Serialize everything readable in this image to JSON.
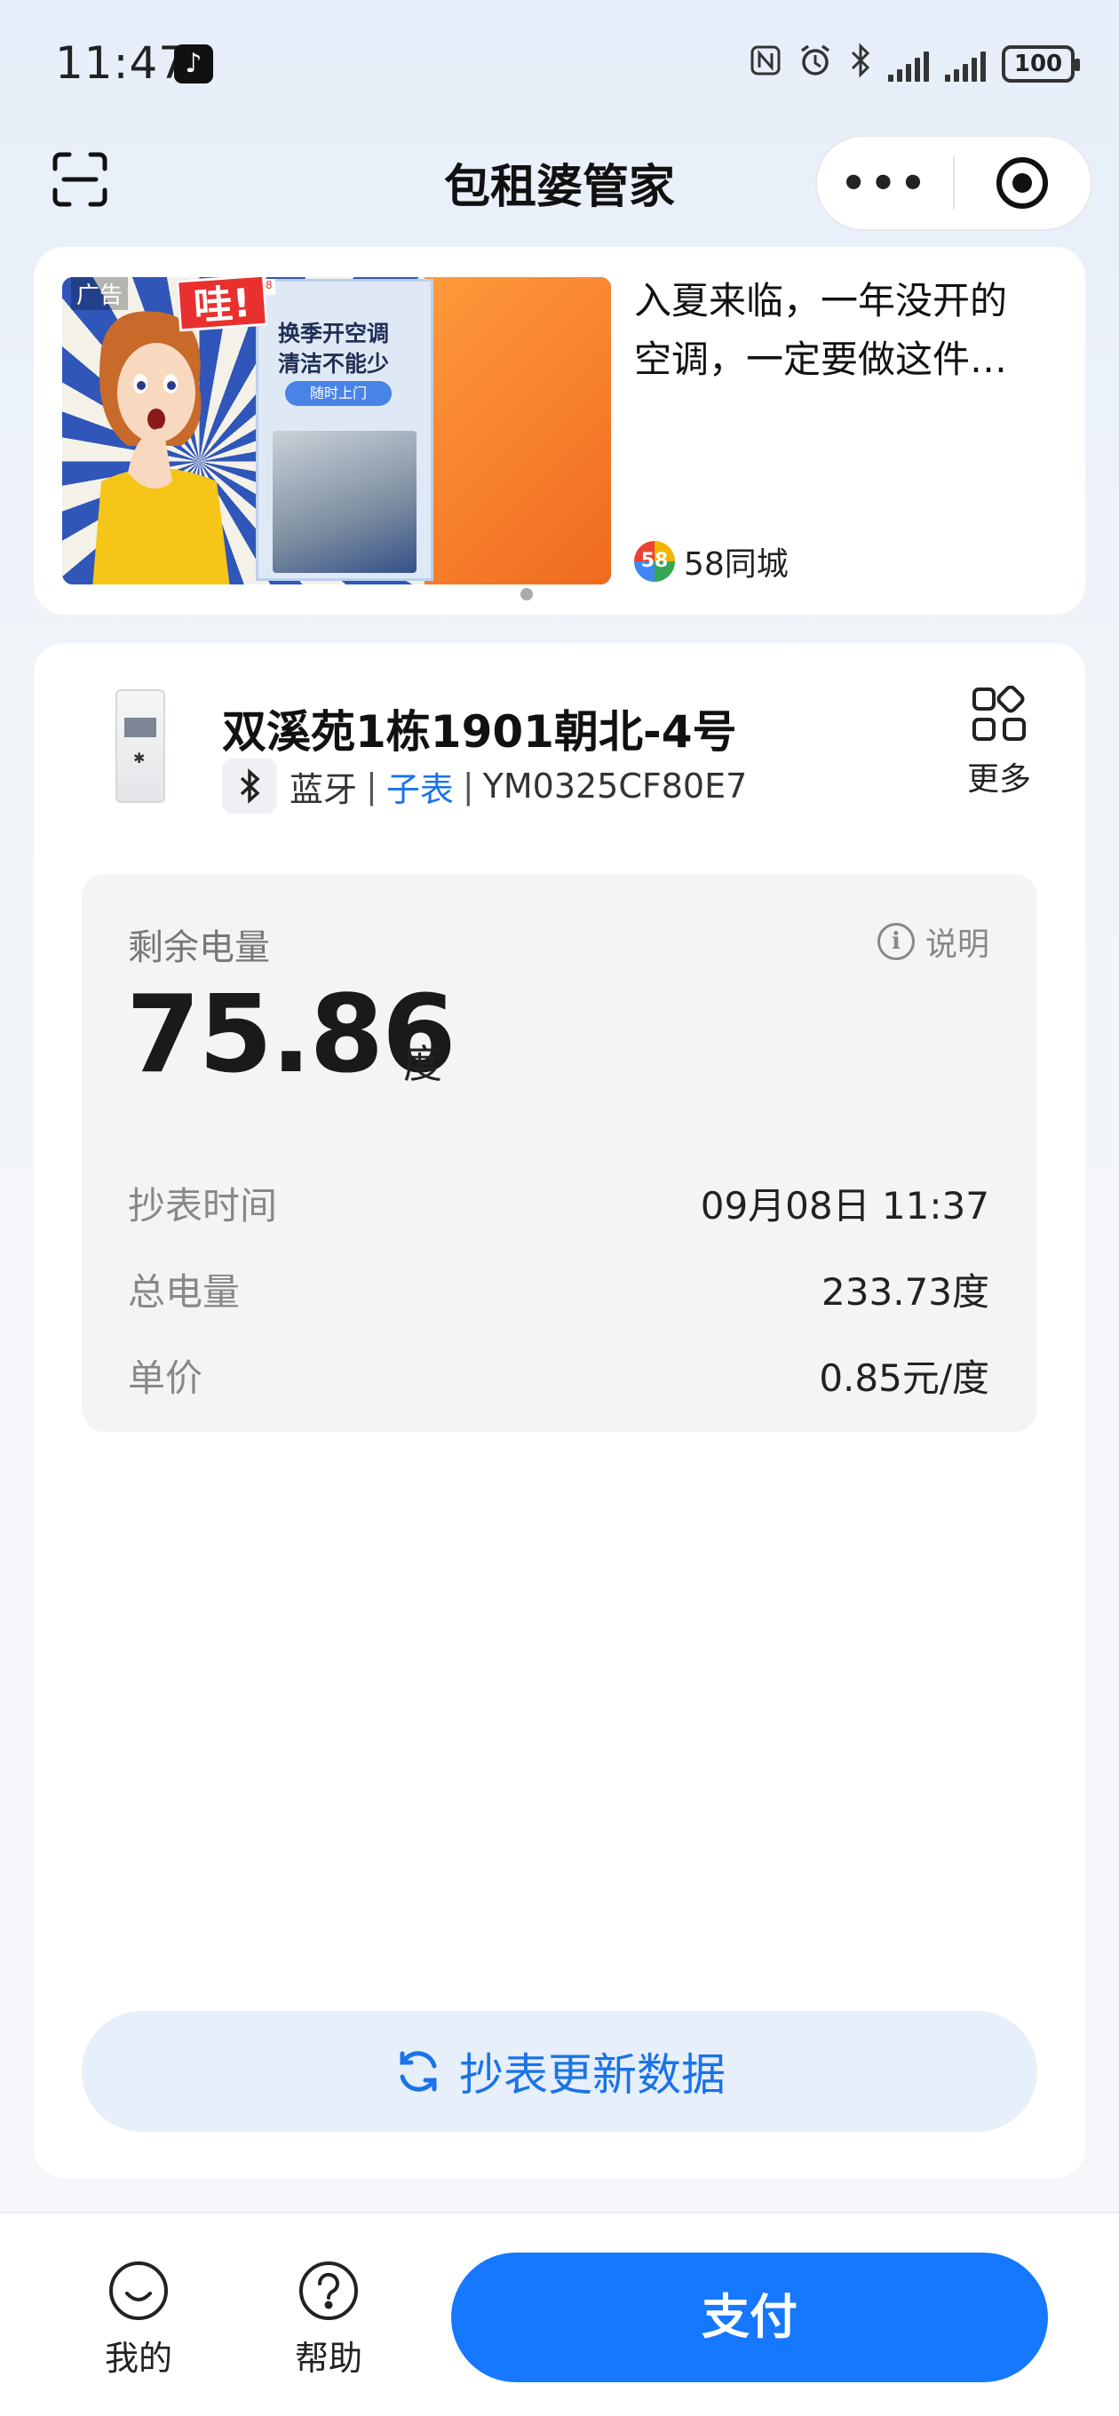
{
  "status_bar": {
    "time": "11:47",
    "battery": "100"
  },
  "header": {
    "title": "包租婆管家",
    "more_icon": "more-dots-icon",
    "close_icon": "target-icon"
  },
  "ad": {
    "label": "广告",
    "image_exclaim": "哇!",
    "image_headline_1": "换季开空调",
    "image_headline_2": "清洁不能少",
    "image_button": "随时上门",
    "text_line1": "入夏来临，一年没开的",
    "text_line2": "空调，一定要做这件…",
    "source": "58同城",
    "source_logo": "58"
  },
  "device": {
    "name": "双溪苑1栋1901朝北-4号",
    "connection": "蓝牙",
    "separator": "|",
    "type": "子表",
    "id": "YM0325CF80E7",
    "more_label": "更多"
  },
  "info": {
    "remaining_label": "剩余电量",
    "explain_label": "说明",
    "remaining_value": "75.86",
    "remaining_unit": "度",
    "rows": [
      {
        "key": "抄表时间",
        "value": "09月08日 11:37"
      },
      {
        "key": "总电量",
        "value": "233.73度"
      },
      {
        "key": "单价",
        "value": "0.85元/度"
      }
    ]
  },
  "actions": {
    "refresh_label": "抄表更新数据"
  },
  "bottom_bar": {
    "mine_label": "我的",
    "help_label": "帮助",
    "pay_label": "支付"
  },
  "colors": {
    "accent": "#1677ff",
    "link": "#1a73e8",
    "refresh_bg": "#e6effa"
  }
}
